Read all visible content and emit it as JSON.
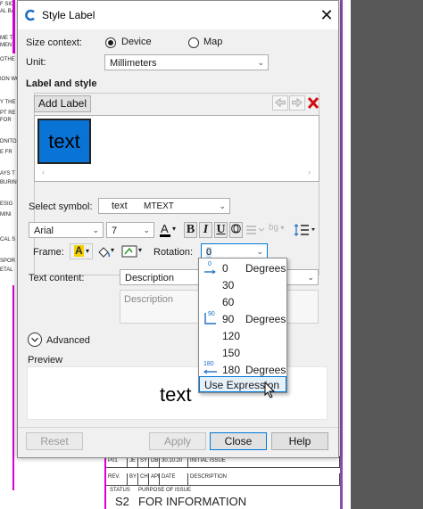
{
  "background": {
    "left_margin_lines": [
      "F SIG",
      "AL BA",
      "ME TI",
      "MEN",
      "OTHE",
      "ION WO",
      "Y THE",
      "PT RE",
      "FOR",
      "DNITO",
      "E FR",
      "AYS T",
      "BURIN",
      "ESIG",
      "MINI",
      "CAL S",
      "SPOR",
      "ETAL"
    ],
    "title_block": {
      "row1": [
        "P01",
        "JE",
        "SY",
        "DB",
        "30.10.20",
        "INITIAL ISSUE"
      ],
      "row2": [
        "REV.",
        "BY",
        "CHK'D",
        "APP'D",
        "DATE",
        "DESCRIPTION"
      ],
      "status_label": "STATUS",
      "purpose_label": "PURPOSE OF ISSUE",
      "status_value": "S2",
      "purpose_value": "FOR INFORMATION"
    }
  },
  "dialog": {
    "title": "Style Label",
    "close_glyph": "✕",
    "size_context": {
      "label": "Size context:",
      "options": [
        {
          "label": "Device",
          "selected": true
        },
        {
          "label": "Map",
          "selected": false
        }
      ]
    },
    "unit": {
      "label": "Unit:",
      "value": "Millimeters"
    },
    "label_and_style": {
      "heading": "Label and style",
      "add_label_button": "Add Label",
      "thumbnail_text": "text"
    },
    "select_symbol": {
      "label": "Select symbol:",
      "preview_text": "text",
      "value": "MTEXT"
    },
    "font": {
      "family": "Arial",
      "size": "7",
      "text_color_letter": "A",
      "bold": "B",
      "italic": "I",
      "underline": "U",
      "outline": "O",
      "bg_label": "bg"
    },
    "frame": {
      "label": "Frame:",
      "a_glyph": "A"
    },
    "rotation": {
      "label": "Rotation:",
      "value": "0",
      "options": [
        {
          "value": "0",
          "unit": "Degrees",
          "icon": "angle-0-icon"
        },
        {
          "value": "30",
          "unit": "",
          "icon": ""
        },
        {
          "value": "60",
          "unit": "",
          "icon": ""
        },
        {
          "value": "90",
          "unit": "Degrees",
          "icon": "angle-90-icon"
        },
        {
          "value": "120",
          "unit": "",
          "icon": ""
        },
        {
          "value": "150",
          "unit": "",
          "icon": ""
        },
        {
          "value": "180",
          "unit": "Degrees",
          "icon": "angle-180-icon"
        }
      ],
      "expression_option": "Use Expression"
    },
    "icon_text": {
      "zero": "0",
      "ninety": "90",
      "oneeighty": "180"
    },
    "text_content": {
      "label": "Text content:",
      "value": "Description",
      "text_area_value": "Description"
    },
    "advanced": {
      "label": "Advanced"
    },
    "preview": {
      "label": "Preview",
      "text": "text"
    },
    "buttons": {
      "reset": "Reset",
      "apply": "Apply",
      "close": "Close",
      "help": "Help"
    },
    "colors": {
      "accent": "#0078d7",
      "thumbnail_fill": "#0a73d6",
      "delete_red": "#d01010"
    }
  }
}
